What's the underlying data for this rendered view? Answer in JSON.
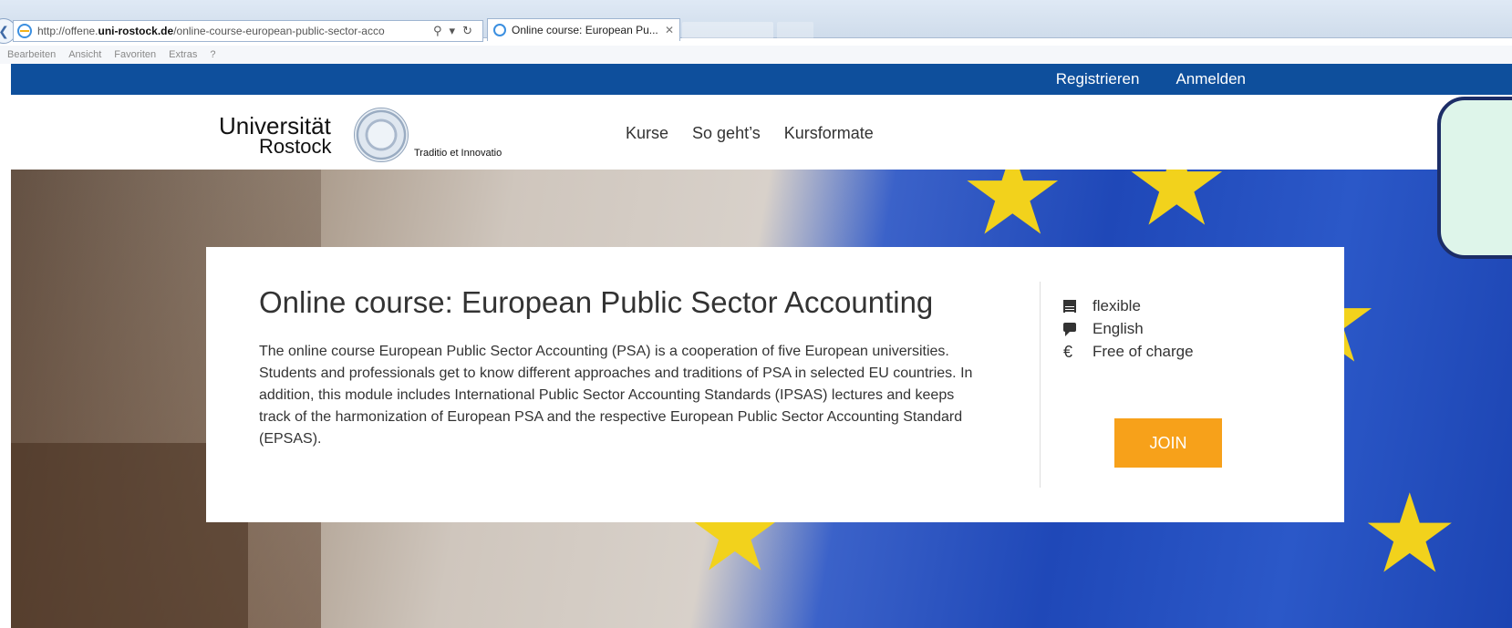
{
  "browser": {
    "url_prefix": "http://offene.",
    "url_domain": "uni-rostock.de",
    "url_rest": "/online-course-european-public-sector-acco",
    "tab_title": "Online course: European Pu...",
    "menu": [
      "Bearbeiten",
      "Ansicht",
      "Favoriten",
      "Extras",
      "?"
    ]
  },
  "topbar": {
    "register": "Registrieren",
    "login": "Anmelden"
  },
  "header": {
    "logo_line1": "Universität",
    "logo_line2": "Rostock",
    "motto": "Traditio et Innovatio",
    "nav": [
      "Kurse",
      "So geht’s",
      "Kursformate"
    ]
  },
  "course": {
    "title": "Online course: European Public Sector Accounting",
    "description": "The online course European Public Sector Accounting (PSA) is a cooperation of five European universities. Students and professionals get to know different approaches and traditions of PSA in selected EU countries. In addition, this module includes International Public Sector Accounting Standards (IPSAS) lectures and keeps track of the harmonization of European PSA and the respective European Public Sector Accounting Standard (EPSAS).",
    "facts": [
      {
        "icon": "calendar-icon",
        "text": "flexible"
      },
      {
        "icon": "speech-bubble-icon",
        "text": "English"
      },
      {
        "icon": "euro-icon",
        "text": "Free of charge"
      }
    ],
    "join_label": "JOIN"
  },
  "colors": {
    "topbar": "#0e4f9c",
    "join_button": "#f7a11a",
    "flag_blue": "#1f48b8",
    "star_yellow": "#f2d21c"
  }
}
